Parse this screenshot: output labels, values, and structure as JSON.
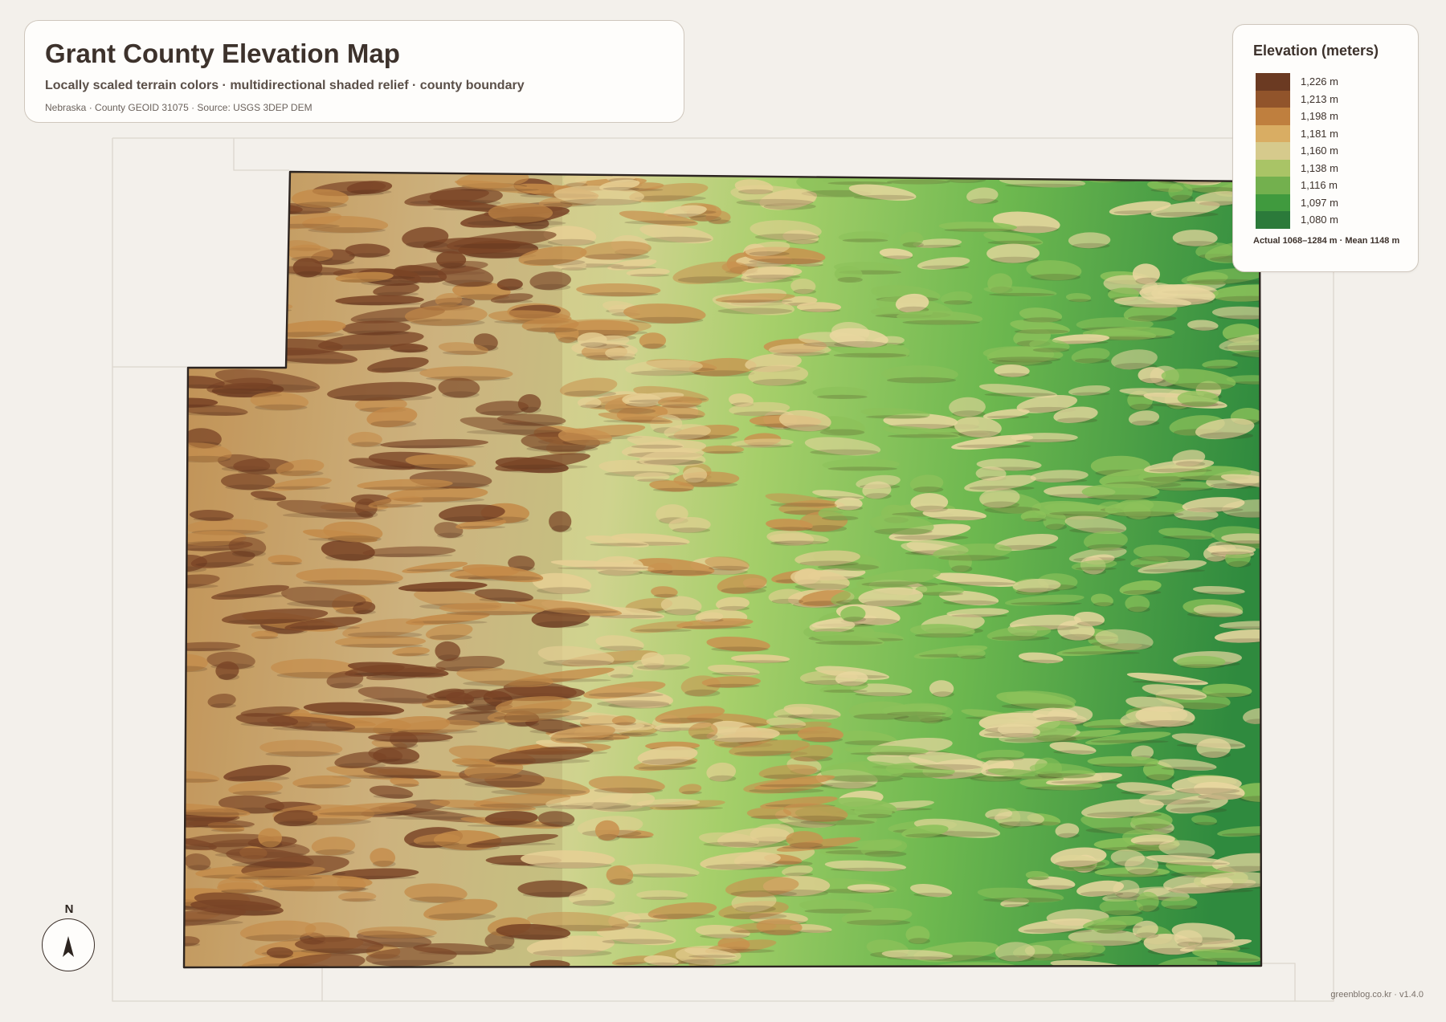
{
  "header": {
    "title": "Grant County Elevation Map",
    "subtitle": "Locally scaled terrain colors · multidirectional shaded relief · county boundary",
    "source": "Nebraska · County GEOID 31075 · Source: USGS 3DEP DEM"
  },
  "legend": {
    "title": "Elevation (meters)",
    "items": [
      {
        "label": "1,226 m",
        "color": "#6b3a22"
      },
      {
        "label": "1,213 m",
        "color": "#91542b"
      },
      {
        "label": "1,198 m",
        "color": "#bf7f3e"
      },
      {
        "label": "1,181 m",
        "color": "#d9ad63"
      },
      {
        "label": "1,160 m",
        "color": "#d6ca8c"
      },
      {
        "label": "1,138 m",
        "color": "#a9c466"
      },
      {
        "label": "1,116 m",
        "color": "#73b04e"
      },
      {
        "label": "1,097 m",
        "color": "#409a3e"
      },
      {
        "label": "1,080 m",
        "color": "#2b7a3a"
      }
    ],
    "stats": "Actual 1068–1284 m · Mean 1148 m"
  },
  "map": {
    "county_name": "Grant County",
    "relief_colors": {
      "high": "#6b3a22",
      "mid": "#d8c98c",
      "low": "#2b7a3a"
    }
  },
  "north_arrow": {
    "label": "N"
  },
  "footer": {
    "credit": "greenblog.co.kr · v1.4.0"
  }
}
